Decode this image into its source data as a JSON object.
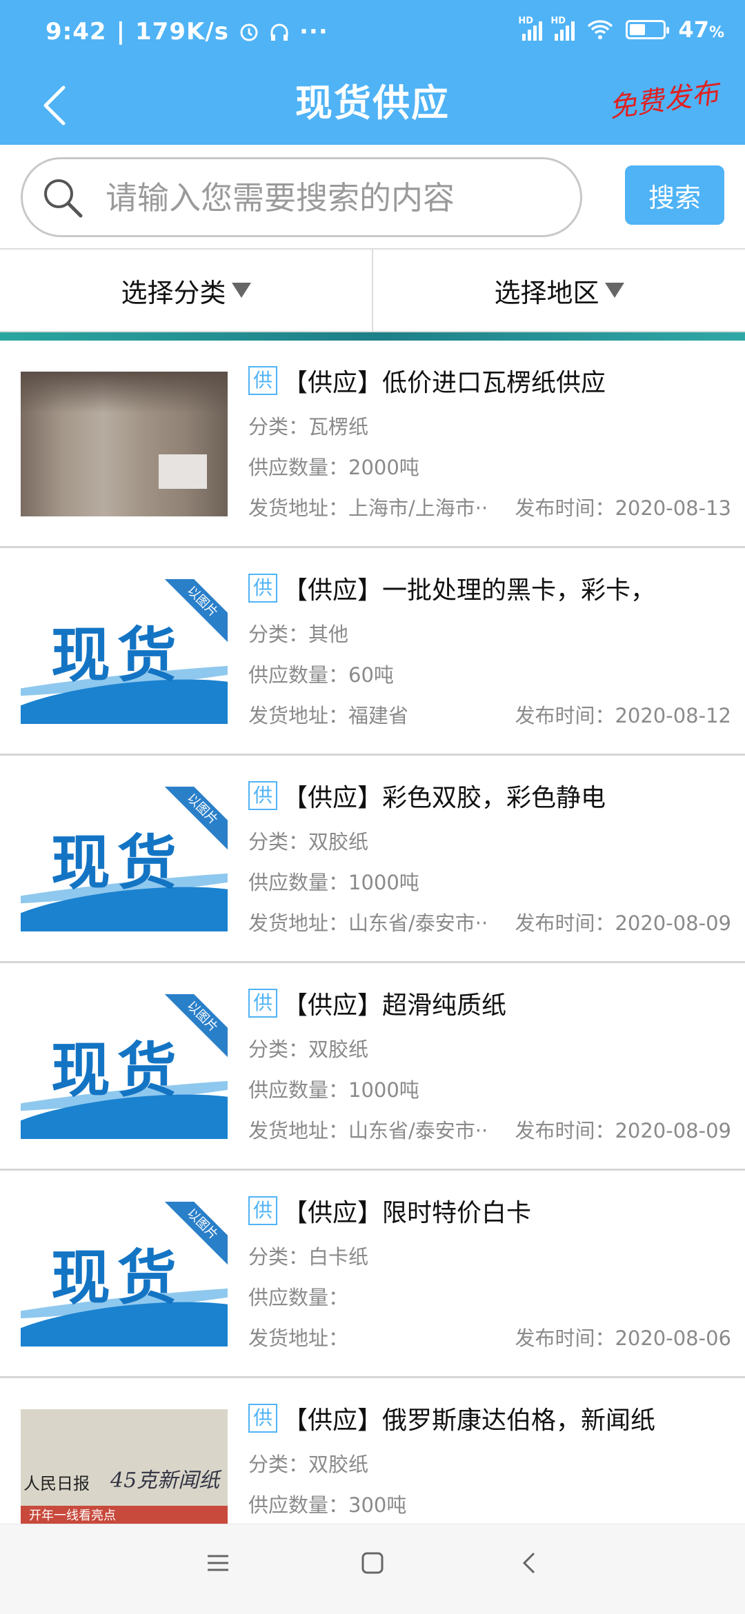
{
  "status_bar": {
    "time": "9:42",
    "net_speed": "179K/s",
    "sim1": "HD",
    "sim2": "HD",
    "battery_percent": "47",
    "battery_unit": "%",
    "battery_level": 0.47
  },
  "header": {
    "title": "现货供应",
    "publish_label": "免费发布"
  },
  "search": {
    "placeholder": "请输入您需要搜索的内容",
    "button_label": "搜索"
  },
  "filters": {
    "category": "选择分类",
    "region": "选择地区"
  },
  "thumb_texts": {
    "stock_word": "现货",
    "stock_ribbon": "以图片",
    "news_head": "人民日报",
    "news_hand": "45克新闻纸",
    "news_bar": "开年一线看亮点"
  },
  "listings": [
    {
      "tag": "供",
      "title": "【供应】低价进口瓦楞纸供应",
      "category": "分类：瓦楞纸",
      "quantity": "供应数量：2000吨",
      "address": "发货地址：上海市/上海市··",
      "date": "发布时间：2020-08-13",
      "thumb": "photo-paper-roll"
    },
    {
      "tag": "供",
      "title": "【供应】一批处理的黑卡，彩卡，",
      "category": "分类：其他",
      "quantity": "供应数量：60吨",
      "address": "发货地址：福建省",
      "date": "发布时间：2020-08-12",
      "thumb": "stock-placeholder"
    },
    {
      "tag": "供",
      "title": "【供应】彩色双胶，彩色静电",
      "category": "分类：双胶纸",
      "quantity": "供应数量：1000吨",
      "address": "发货地址：山东省/泰安市··",
      "date": "发布时间：2020-08-09",
      "thumb": "stock-placeholder"
    },
    {
      "tag": "供",
      "title": "【供应】超滑纯质纸",
      "category": "分类：双胶纸",
      "quantity": "供应数量：1000吨",
      "address": "发货地址：山东省/泰安市··",
      "date": "发布时间：2020-08-09",
      "thumb": "stock-placeholder"
    },
    {
      "tag": "供",
      "title": "【供应】限时特价白卡",
      "category": "分类：白卡纸",
      "quantity": "供应数量：",
      "address": "发货地址：",
      "date": "发布时间：2020-08-06",
      "thumb": "stock-placeholder"
    },
    {
      "tag": "供",
      "title": "【供应】俄罗斯康达伯格，新闻纸",
      "category": "分类：双胶纸",
      "quantity": "供应数量：300吨",
      "address": "",
      "date": "",
      "thumb": "photo-newspaper"
    }
  ],
  "nav": {
    "menu_icon": "menu-icon",
    "home_icon": "home-square-icon",
    "back_icon": "back-chevron-icon"
  },
  "colors": {
    "accent": "#4fb3f6",
    "publish_red": "#e02020",
    "stock_blue": "#1474c4"
  }
}
